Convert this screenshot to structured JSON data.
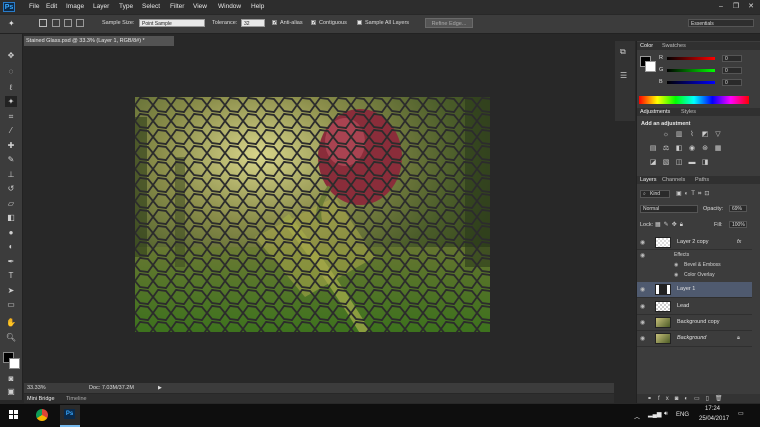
{
  "app": {
    "logo": "Ps"
  },
  "menu": [
    "File",
    "Edit",
    "Image",
    "Layer",
    "Type",
    "Select",
    "Filter",
    "View",
    "Window",
    "Help"
  ],
  "window_controls": {
    "minimize": "–",
    "restore": "❐",
    "close": "✕"
  },
  "options": {
    "sample_size_label": "Sample Size:",
    "sample_size_value": "Point Sample",
    "tolerance_label": "Tolerance:",
    "tolerance_value": "32",
    "anti_alias": "Anti-alias",
    "contiguous": "Contiguous",
    "sample_all_layers": "Sample All Layers",
    "refine_edge": "Refine Edge...",
    "workspace": "Essentials"
  },
  "document": {
    "tab_title": "Stained Glass.psd @ 33.3% (Layer 1, RGB/8#) *",
    "zoom": "33.33%",
    "doc_size": "Doc: 7.03M/37.2M"
  },
  "bottom_tabs": [
    "Mini Bridge",
    "Timeline"
  ],
  "color_panel": {
    "tabs": [
      "Color",
      "Swatches"
    ],
    "channels": [
      {
        "label": "R",
        "value": "0"
      },
      {
        "label": "G",
        "value": "0"
      },
      {
        "label": "B",
        "value": "0"
      }
    ]
  },
  "adjustments_panel": {
    "tabs": [
      "Adjustments",
      "Styles"
    ],
    "title": "Add an adjustment"
  },
  "layers_panel": {
    "tabs": [
      "Layers",
      "Channels",
      "Paths"
    ],
    "filter": "Kind",
    "blend_mode": "Normal",
    "opacity_label": "Opacity:",
    "opacity_value": "69%",
    "lock_label": "Lock:",
    "fill_label": "Fill:",
    "fill_value": "100%",
    "layers": [
      {
        "name": "Layer 2 copy",
        "fx": "fx"
      },
      {
        "name": "Effects"
      },
      {
        "name": "Bevel & Emboss"
      },
      {
        "name": "Color Overlay"
      },
      {
        "name": "Layer 1"
      },
      {
        "name": "Lead"
      },
      {
        "name": "Background copy"
      },
      {
        "name": "Background"
      }
    ]
  },
  "taskbar": {
    "language": "ENG",
    "time": "17:24",
    "date": "25/04/2017"
  },
  "colors": {
    "accent": "#31a8ff",
    "selected_layer": "#4f5a6f"
  }
}
